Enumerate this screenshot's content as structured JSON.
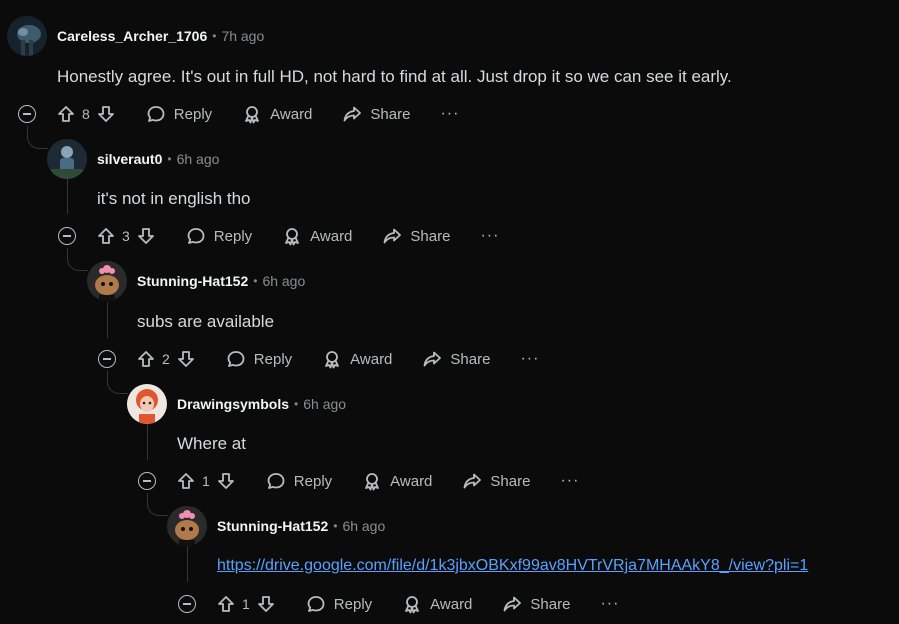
{
  "comments": [
    {
      "username": "Careless_Archer_1706",
      "time": "7h ago",
      "text": "Honestly agree. It's out in full HD, not hard to find at all. Just drop it so we can see it early.",
      "votes": "8",
      "avatar_icon": "alien-avatar-icon"
    },
    {
      "username": "silveraut0",
      "time": "6h ago",
      "text": "it's not in english tho",
      "votes": "3",
      "avatar_icon": "figure-avatar-icon"
    },
    {
      "username": "Stunning-Hat152",
      "time": "6h ago",
      "text": "subs are available",
      "votes": "2",
      "avatar_icon": "snoo-flower-avatar-icon"
    },
    {
      "username": "Drawingsymbols",
      "time": "6h ago",
      "text": "Where at",
      "votes": "1",
      "avatar_icon": "redhead-avatar-icon"
    },
    {
      "username": "Stunning-Hat152",
      "time": "6h ago",
      "text": "https://drive.google.com/file/d/1k3jbxOBKxf99av8HVTrVRja7MHAAkY8_/view?pli=1",
      "votes": "1",
      "avatar_icon": "snoo-flower-avatar-icon"
    }
  ],
  "actions": {
    "reply": "Reply",
    "award": "Award",
    "share": "Share",
    "more": "···"
  },
  "colors": {
    "background": "#0b0b0b",
    "link": "#5aa1ff",
    "thread_line": "#343536"
  }
}
